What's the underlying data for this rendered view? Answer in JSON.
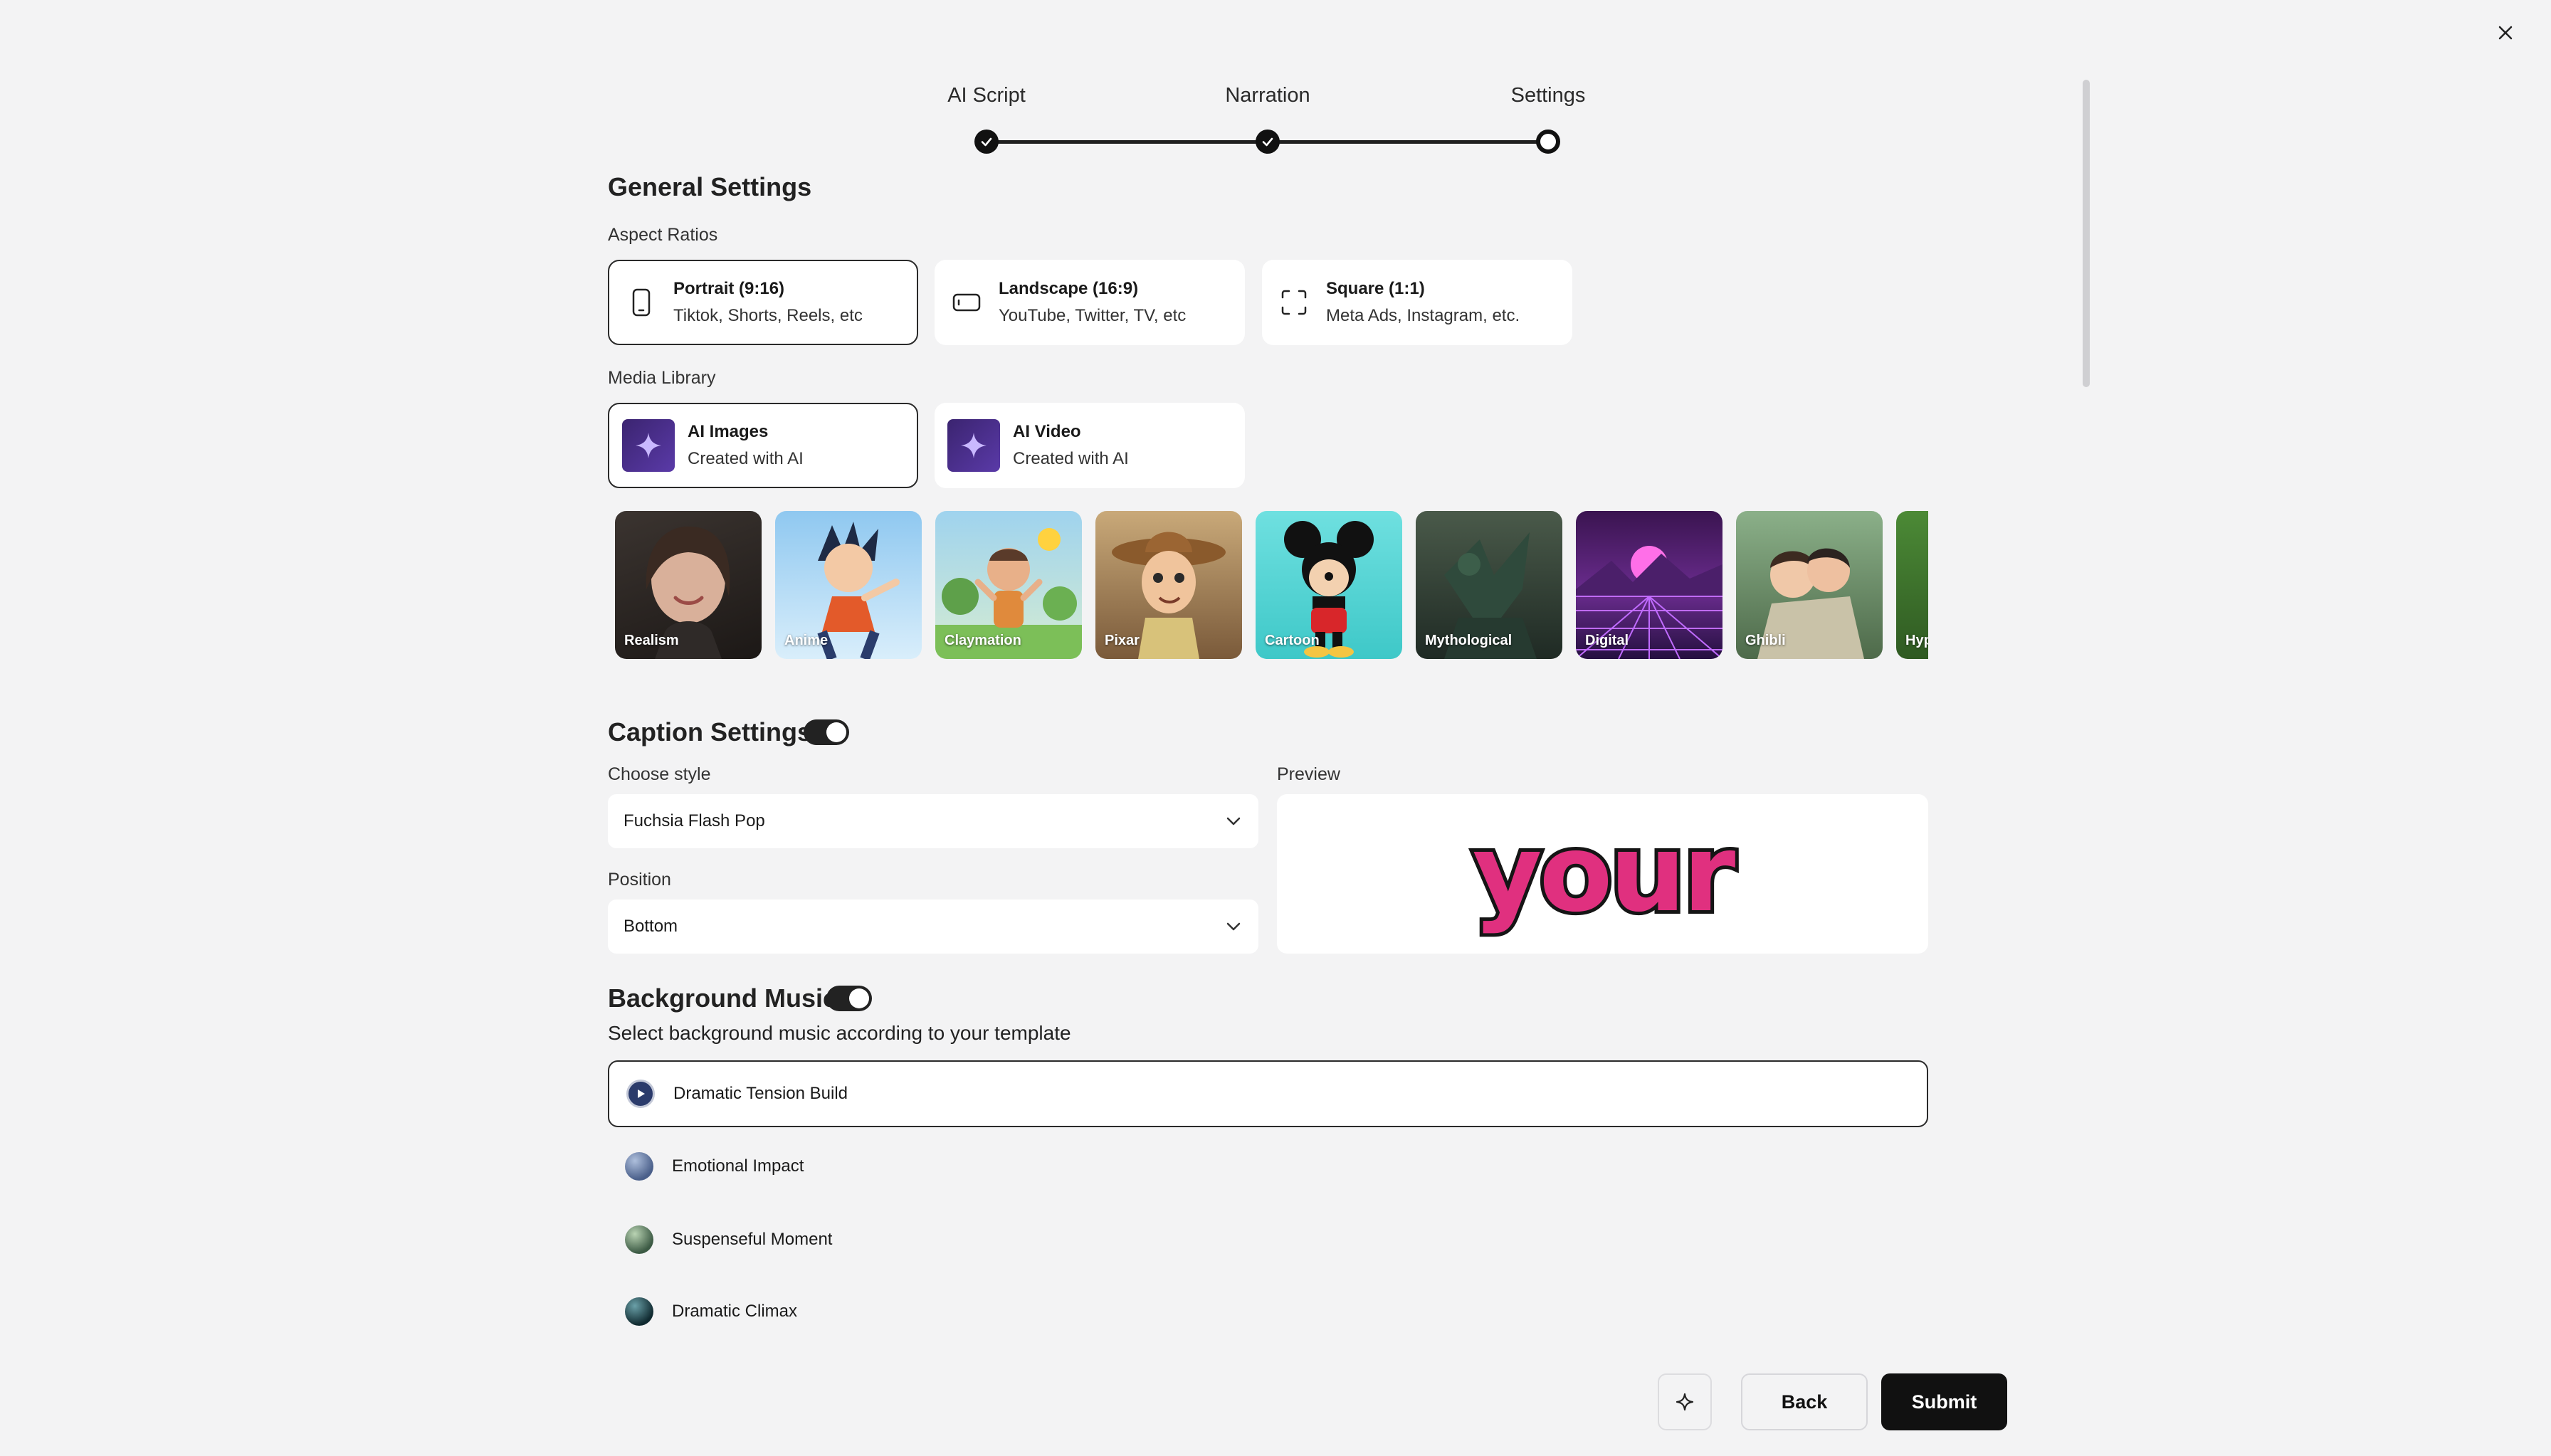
{
  "stepper": {
    "steps": [
      {
        "label": "AI Script",
        "state": "done"
      },
      {
        "label": "Narration",
        "state": "done"
      },
      {
        "label": "Settings",
        "state": "current"
      }
    ]
  },
  "general": {
    "title": "General Settings",
    "aspect_label": "Aspect Ratios",
    "aspect_options": [
      {
        "title": "Portrait (9:16)",
        "subtitle": "Tiktok, Shorts, Reels, etc",
        "icon": "portrait-phone-icon",
        "selected": true
      },
      {
        "title": "Landscape (16:9)",
        "subtitle": "YouTube, Twitter, TV, etc",
        "icon": "landscape-phone-icon",
        "selected": false
      },
      {
        "title": "Square (1:1)",
        "subtitle": "Meta Ads, Instagram, etc.",
        "icon": "square-frame-icon",
        "selected": false
      }
    ],
    "media_label": "Media Library",
    "media_options": [
      {
        "title": "AI Images",
        "subtitle": "Created with AI",
        "icon": "sparkle-icon",
        "selected": true
      },
      {
        "title": "AI Video",
        "subtitle": "Created with AI",
        "icon": "sparkle-icon",
        "selected": false
      }
    ],
    "styles": [
      "Realism",
      "Anime",
      "Claymation",
      "Pixar",
      "Cartoon",
      "Mythological",
      "Digital",
      "Ghibli",
      "Hyp"
    ]
  },
  "caption": {
    "title": "Caption Settings",
    "enabled": true,
    "style_label": "Choose style",
    "style_value": "Fuchsia Flash Pop",
    "position_label": "Position",
    "position_value": "Bottom",
    "preview_label": "Preview",
    "preview_word": "your",
    "preview_fill": "#e0307f"
  },
  "music": {
    "title": "Background Music",
    "enabled": true,
    "description": "Select background music according to your template",
    "tracks": [
      {
        "name": "Dramatic Tension Build",
        "selected": true
      },
      {
        "name": "Emotional Impact",
        "selected": false
      },
      {
        "name": "Suspenseful Moment",
        "selected": false
      },
      {
        "name": "Dramatic Climax",
        "selected": false
      }
    ]
  },
  "footer": {
    "back_label": "Back",
    "submit_label": "Submit",
    "magic_icon": "sparkle-outline-icon"
  },
  "colors": {
    "accent": "#111111",
    "background": "#f3f3f4"
  }
}
